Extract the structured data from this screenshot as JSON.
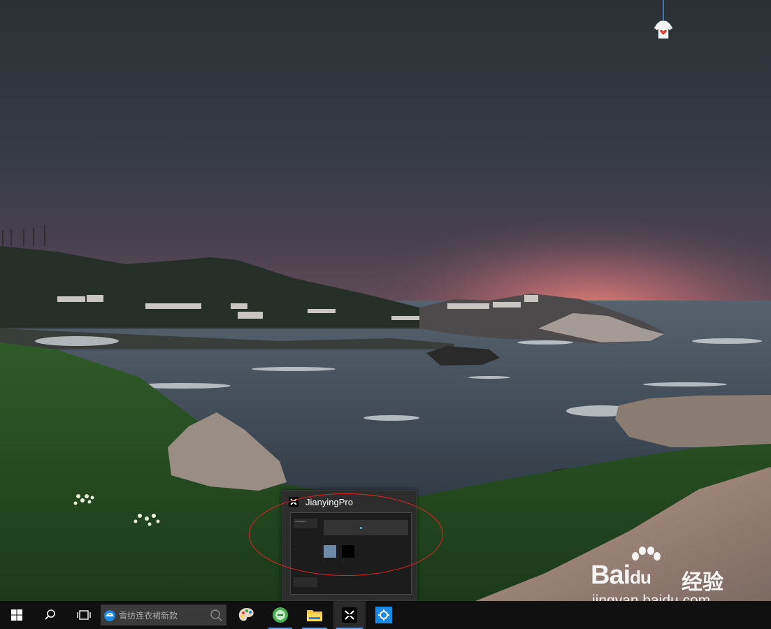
{
  "thumbnail": {
    "title": "JianyingPro",
    "preview": {
      "user_name": "JianyingPro",
      "user_sub": "...",
      "menu": [
        "...",
        "...",
        "..."
      ],
      "start_label": "...",
      "drafts_label": "...",
      "drafts": [
        "...",
        "..."
      ],
      "promo": "..."
    }
  },
  "taskbar": {
    "search_placeholder": "雪纺连衣裙新款",
    "apps": [
      "ie-browser",
      "paint-app",
      "green-app",
      "file-explorer",
      "jianying",
      "settings"
    ]
  },
  "watermark": {
    "brand": "Bai",
    "paw": "du",
    "cn": "经验",
    "url": "jingyan.baidu.com"
  },
  "colors": {
    "annotation": "#e3231e",
    "taskbar": "#101010",
    "accent": "#5ea0e6"
  }
}
